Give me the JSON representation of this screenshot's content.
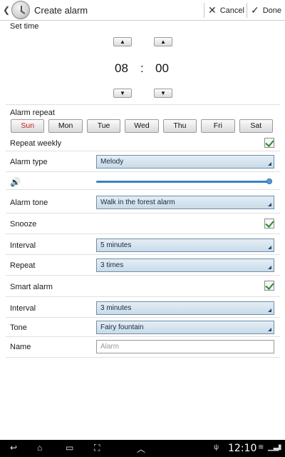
{
  "header": {
    "title": "Create alarm",
    "cancel_label": "Cancel",
    "done_label": "Done"
  },
  "set_time": {
    "label": "Set time",
    "hour": "08",
    "separator": ":",
    "minute": "00"
  },
  "alarm_repeat": {
    "label": "Alarm repeat",
    "days": [
      "Sun",
      "Mon",
      "Tue",
      "Wed",
      "Thu",
      "Fri",
      "Sat"
    ]
  },
  "repeat_weekly": {
    "label": "Repeat weekly",
    "checked": true
  },
  "alarm_type": {
    "label": "Alarm type",
    "value": "Melody"
  },
  "volume": {
    "level": 1.0
  },
  "alarm_tone": {
    "label": "Alarm tone",
    "value": "Walk in the forest alarm"
  },
  "snooze": {
    "label": "Snooze",
    "checked": true,
    "interval_label": "Interval",
    "interval_value": "5 minutes",
    "repeat_label": "Repeat",
    "repeat_value": "3 times"
  },
  "smart_alarm": {
    "label": "Smart alarm",
    "checked": true,
    "interval_label": "Interval",
    "interval_value": "3 minutes",
    "tone_label": "Tone",
    "tone_value": "Fairy fountain"
  },
  "name_field": {
    "label": "Name",
    "placeholder": "Alarm"
  },
  "status_bar": {
    "time": "12:10"
  },
  "colors": {
    "accent": "#2a6fb0",
    "sunday": "#c02020",
    "check": "#2e8b2e",
    "dropdown_bg": "#d6e4ef"
  }
}
